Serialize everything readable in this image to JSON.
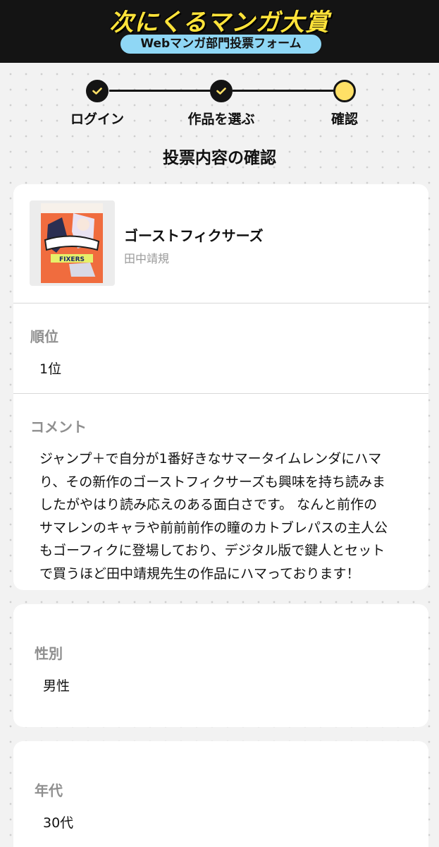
{
  "header": {
    "logo_text": "次にくるマンガ大賞",
    "form_label": "Webマンガ部門投票フォーム"
  },
  "steps": [
    {
      "label": "ログイン",
      "status": "done"
    },
    {
      "label": "作品を選ぶ",
      "status": "done"
    },
    {
      "label": "確認",
      "status": "current"
    }
  ],
  "page_title": "投票内容の確認",
  "vote": {
    "title": "ゴーストフィクサーズ",
    "author": "田中靖規",
    "cover_text": "FIXERS",
    "rank_label": "順位",
    "rank_value": "1位",
    "comment_label": "コメント",
    "comment_lines": [
      "ジャンプ＋で自分が1番好きなサマータイムレンダにハマ",
      "り、その新作のゴーストフィクサーズも興味を持ち読みま",
      "したがやはり読み応えのある面白さです。 なんと前作の",
      "サマレンのキャラや前前前作の瞳のカトブレパスの主人公",
      "もゴーフィクに登場しており、デジタル版で鍵人とセット",
      "で買うほど田中靖規先生の作品にハマっております！"
    ]
  },
  "profile": {
    "gender_label": "性別",
    "gender_value": "男性",
    "age_label": "年代",
    "age_value": "30代"
  },
  "colors": {
    "header_bg": "#141414",
    "logo_yellow": "#ffe33a",
    "pill_blue": "#8fd7f5",
    "step_current": "#ffe066"
  }
}
